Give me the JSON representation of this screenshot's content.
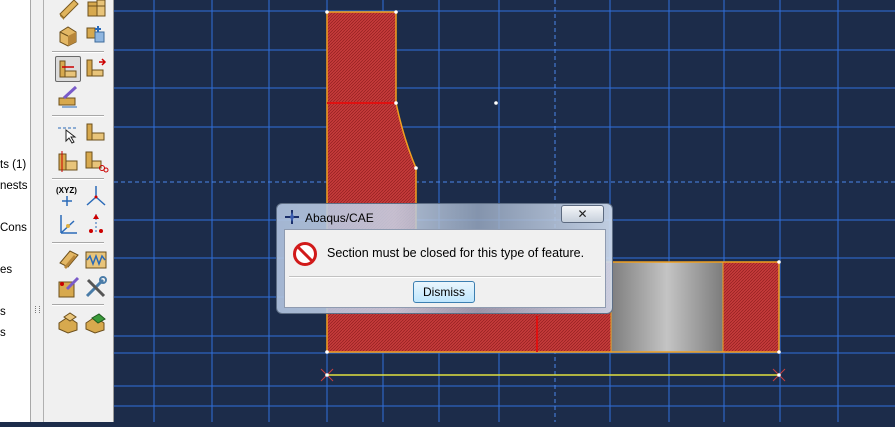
{
  "model_tree": {
    "items": [
      {
        "label": "ts (1)"
      },
      {
        "label": "nests"
      },
      {
        "label": "Cons"
      },
      {
        "label": "es"
      },
      {
        "label": "s"
      },
      {
        "label": "s"
      }
    ]
  },
  "toolbox": {
    "tools": [
      {
        "icon": "extrude-solid-icon"
      },
      {
        "icon": "revolve-solid-icon"
      },
      {
        "icon": "sweep-solid-icon"
      },
      {
        "icon": "shell-icon"
      },
      {
        "icon": "partition-face-icon"
      },
      {
        "icon": "partition-cell-icon"
      },
      {
        "icon": "edit-feature-icon"
      },
      {
        "icon": "datum-point-icon"
      },
      {
        "icon": "datum-axis-icon"
      },
      {
        "icon": "create-cut-icon"
      },
      {
        "icon": "split-cell-icon"
      },
      {
        "icon": "csys-xyz-icon"
      },
      {
        "icon": "triad-icon"
      },
      {
        "icon": "datum-plane-icon"
      },
      {
        "icon": "edit-datum-icon"
      },
      {
        "icon": "repair-face-icon"
      },
      {
        "icon": "wire-spring-icon"
      },
      {
        "icon": "query-icon"
      },
      {
        "icon": "tools-icon"
      },
      {
        "icon": "part-instance-icon"
      },
      {
        "icon": "part-replace-icon"
      }
    ]
  },
  "viewport": {
    "background": "#1c2c4a",
    "grid_color": "#2f6fdc",
    "region_fill": "#c23a3a",
    "outline_color": "#f0a020",
    "dimension_color": "#e0e040"
  },
  "dialog": {
    "title": "Abaqus/CAE",
    "close_glyph": "✕",
    "message": "Section must be closed for this type of feature.",
    "dismiss_label": "Dismiss",
    "icon": "error-stop-icon"
  }
}
